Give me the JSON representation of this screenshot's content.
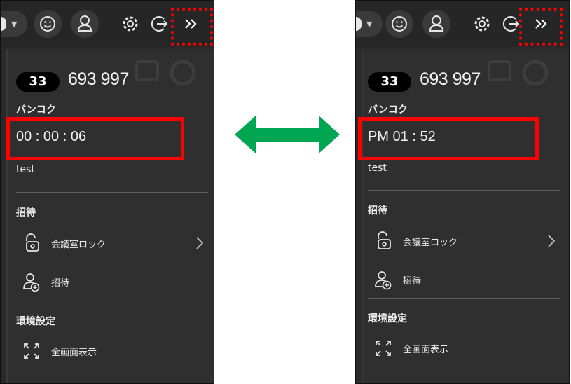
{
  "left": {
    "country_code": "33",
    "room_number": "693 997",
    "city": "バンコク",
    "time_display": "00 : 00 : 06",
    "meeting_name": "test",
    "invite_section": "招待",
    "lock_room_label": "会議室ロック",
    "invite_label": "招待",
    "settings_section": "環境設定",
    "fullscreen_label": "全画面表示"
  },
  "right": {
    "country_code": "33",
    "room_number": "693 997",
    "city": "バンコク",
    "time_display": "PM 01 : 52",
    "meeting_name": "test",
    "invite_section": "招待",
    "lock_room_label": "会議室ロック",
    "invite_label": "招待",
    "settings_section": "環境設定",
    "fullscreen_label": "全画面表示"
  },
  "icons": {
    "toolbar": [
      "dropdown-caret-icon",
      "smiley-icon",
      "user-icon",
      "gear-icon",
      "exit-icon",
      "double-chevron-right-icon"
    ],
    "rows": [
      "padlock-icon",
      "add-user-icon",
      "fullscreen-icon"
    ]
  },
  "colors": {
    "panel_bg": "#2b2b2b",
    "highlight": "#ff0000",
    "swap_arrow": "#00a652"
  }
}
